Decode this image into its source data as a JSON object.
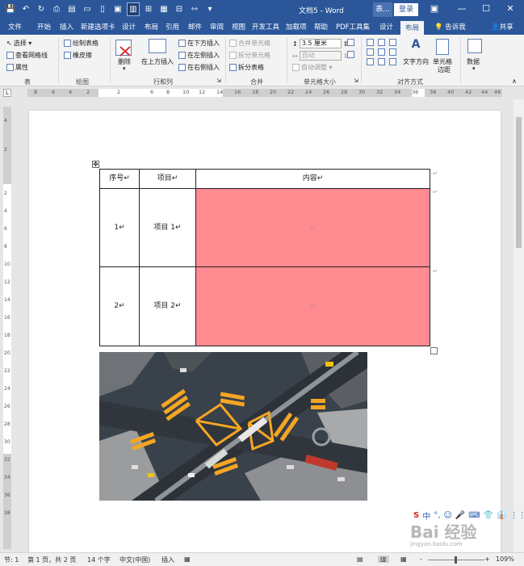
{
  "title_bar": {
    "document_title": "文档5 - Word",
    "context_tab": "表...",
    "login_label": "登录",
    "qat_icons": [
      "save-icon",
      "undo-icon",
      "redo-icon",
      "print-preview-icon",
      "quick-print-icon",
      "open-icon",
      "new-doc-icon",
      "screenshot-icon",
      "read-mode-icon",
      "grid-icon",
      "layout-icon",
      "table-icon",
      "align-icon",
      "more-icon"
    ]
  },
  "tabs": [
    "文件",
    "开始",
    "插入",
    "新建选项卡",
    "设计",
    "布局",
    "引用",
    "邮件",
    "审阅",
    "视图",
    "开发工具",
    "加载项",
    "帮助",
    "PDF工具集",
    "设计",
    "布局"
  ],
  "active_tab": "布局",
  "tell_me": "告诉我",
  "share": "共享",
  "ribbon": {
    "groups": {
      "table": {
        "label": "表",
        "items": [
          "选择 ▾",
          "查看网格线",
          "属性"
        ]
      },
      "draw": {
        "label": "绘图",
        "items": [
          "绘制表格",
          "橡皮擦"
        ]
      },
      "rows_cols": {
        "label": "行和列",
        "delete": "删除",
        "insert_above": "在上方插入",
        "items": [
          "在下方插入",
          "在左侧插入",
          "在右侧插入"
        ]
      },
      "merge": {
        "label": "合并",
        "items": [
          "合并单元格",
          "拆分单元格",
          "拆分表格"
        ]
      },
      "cell_size": {
        "label": "单元格大小",
        "height_value": "3.5 厘米",
        "width_value": "自动",
        "autofit": "自动调整 ▾"
      },
      "alignment": {
        "label": "对齐方式",
        "text_direction": "文字方向",
        "cell_margins_line1": "单元格",
        "cell_margins_line2": "边距"
      },
      "data": {
        "label": "",
        "data_button": "数据"
      }
    }
  },
  "ruler": {
    "corner": "L",
    "numbers": [
      "8",
      "6",
      "4",
      "2",
      "2",
      "6",
      "8",
      "10",
      "12",
      "14",
      "16",
      "18",
      "20",
      "22",
      "24",
      "26",
      "28",
      "30",
      "32",
      "34",
      "36",
      "38",
      "40",
      "42",
      "44",
      "46"
    ],
    "vertical_numbers": [
      "4",
      "2",
      "2",
      "4",
      "6",
      "8",
      "10",
      "12",
      "14",
      "16",
      "18",
      "20",
      "22",
      "24",
      "26",
      "28",
      "30",
      "32",
      "34",
      "36",
      "38"
    ]
  },
  "document": {
    "table": {
      "headers": [
        "序号↵",
        "项目↵",
        "内容↵"
      ],
      "rows": [
        {
          "no": "1↵",
          "item": "项目 1↵",
          "content": "↵"
        },
        {
          "no": "2↵",
          "item": "项目 2↵",
          "content": "↵"
        }
      ],
      "highlight_color": "#ff8a8f",
      "row_end_mark": "↵"
    },
    "image": {
      "name": "city-intersection-aerial-photo"
    }
  },
  "status_bar": {
    "section": "节: 1",
    "page": "第 1 页，共 2 页",
    "words": "14 个字",
    "language": "中文(中国)",
    "mode": "插入",
    "zoom": "109%",
    "zoom_minus": "-",
    "zoom_plus": "+"
  },
  "ime_toolbar": {
    "logo": "S",
    "items": [
      "中",
      "°,",
      "☺",
      "🎤",
      "⌨",
      "👕",
      "👔",
      "⋮⋮"
    ]
  },
  "watermark": {
    "text": "Bai 经验",
    "url": "jingyan.baidu.com"
  },
  "colors": {
    "title_bar_bg": "#2b579a",
    "ribbon_bg": "#f3f3f3",
    "cell_highlight": "#ff8a8f"
  }
}
